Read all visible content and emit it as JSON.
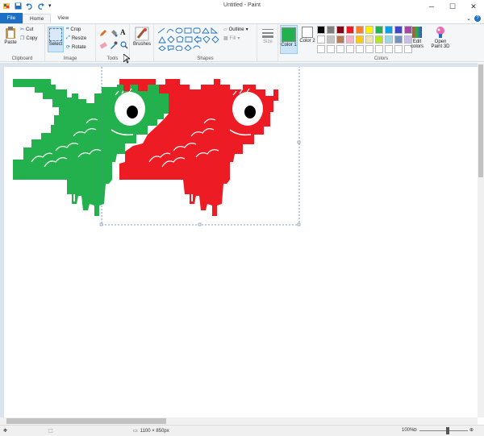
{
  "window": {
    "title": "Untitled - Paint"
  },
  "tabs": {
    "file": "File",
    "home": "Home",
    "view": "View"
  },
  "ribbon": {
    "clipboard": {
      "label": "Clipboard",
      "paste": "Paste",
      "cut": "Cut",
      "copy": "Copy"
    },
    "image": {
      "label": "Image",
      "select": "Select",
      "crop": "Crop",
      "resize": "Resize",
      "rotate": "Rotate"
    },
    "tools": {
      "label": "Tools"
    },
    "brushes": {
      "label": "Brushes"
    },
    "shapes": {
      "label": "Shapes",
      "outline": "Outline",
      "fill": "Fill"
    },
    "size": {
      "label": "Size"
    },
    "colors": {
      "label": "Colors",
      "color1": "Color 1",
      "color2": "Color 2",
      "edit_colors": "Edit colors",
      "open_paint3d": "Open Paint 3D",
      "color1_value": "#22b14c",
      "color2_value": "#ffffff",
      "palette": [
        "#000000",
        "#7f7f7f",
        "#880015",
        "#ed1c24",
        "#ff7f27",
        "#fff200",
        "#22b14c",
        "#00a2e8",
        "#3f48cc",
        "#a349a4",
        "#ffffff",
        "#c3c3c3",
        "#b97a57",
        "#ffaec9",
        "#ffc90e",
        "#efe4b0",
        "#b5e61d",
        "#99d9ea",
        "#7092be",
        "#c8bfe7",
        "#ffffff",
        "#ffffff",
        "#ffffff",
        "#ffffff",
        "#ffffff",
        "#ffffff",
        "#ffffff",
        "#ffffff",
        "#ffffff",
        "#ffffff"
      ]
    }
  },
  "canvas": {
    "fish_green": "#22b14c",
    "fish_red": "#ed1c24"
  },
  "status": {
    "size": "1100 × 850px",
    "zoom": "100%"
  }
}
